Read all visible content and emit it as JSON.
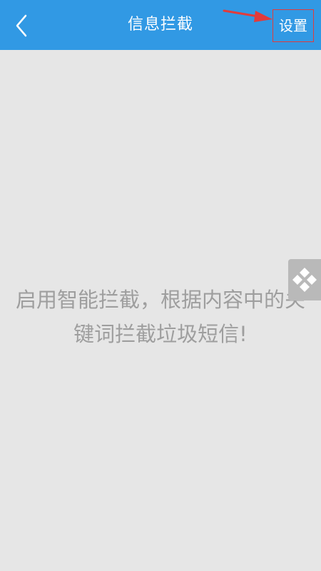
{
  "header": {
    "title": "信息拦截",
    "settings_label": "设置",
    "back_icon": "chevron-left-icon",
    "background_color": "#3199e4"
  },
  "main": {
    "empty_message": "启用智能拦截，根据内容中的关键词拦截垃圾短信!"
  },
  "floating_widget": {
    "icon": "diamond-grid-icon",
    "background_color": "#b9b9b9"
  },
  "annotations": {
    "arrow_color": "#e23b3b",
    "highlight_color": "#e23b3b"
  }
}
